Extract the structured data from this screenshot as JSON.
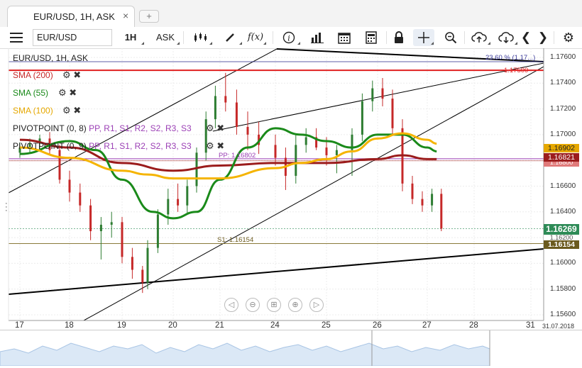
{
  "tab": {
    "label": "EUR/USD, 1H, ASK",
    "close": "×",
    "new_tab": "+"
  },
  "toolbar": {
    "symbol": "EUR/USD",
    "timeframe": "1H",
    "side": "ASK",
    "icons": [
      "hamburger-menu-icon",
      "candle-type-icon",
      "pencil-icon",
      "fx-indicator-icon",
      "info-icon",
      "bar-chart-icon",
      "calendar-icon",
      "report-icon",
      "lock-icon",
      "crosshair-icon",
      "zoom-icon",
      "upload-icon",
      "download-icon",
      "prev-icon",
      "next-icon",
      "settings-icon"
    ]
  },
  "legend": {
    "instrument": "EUR/USD, 1H, ASK",
    "sma200": "SMA (200)",
    "sma55": "SMA (55)",
    "sma100": "SMA (100)",
    "pivot8_name": "PIVOTPOINT (0, 8)",
    "pivot8_levels": "PP, R1, S1, R2, S2, R3, S3",
    "pivot9_name": "PIVOTPOINT (0, 9)",
    "pivot9_levels": "PP, R1, S1, R2, S2, R3, S3"
  },
  "annotations": {
    "fib": "23.60 % (1.17...)",
    "red_level": "1.17500",
    "pp": "PP: 1.16802",
    "s1": "S1: 1.16154"
  },
  "price_boxes": {
    "sma55": "1.16902",
    "sma200": "1.16821",
    "last": "1.16269",
    "s1": "1.16154",
    "hidden1": "1.16800",
    "hidden2": "1.16200"
  },
  "colors": {
    "sma200": "#9b1c1c",
    "sma55": "#1a8a1a",
    "sma100": "#f5b400",
    "pivot": "#9b3fb5",
    "red_level": "#e02020",
    "up": "#2e7d32",
    "down": "#c62828",
    "last_price": "#2e8b57",
    "s1_box": "#6b5a1e"
  },
  "y_axis": [
    "1.17600",
    "1.17400",
    "1.17200",
    "1.17000",
    "1.16800",
    "1.16600",
    "1.16400",
    "1.16200",
    "1.16000",
    "1.15800",
    "1.15600"
  ],
  "x_axis": [
    "17",
    "18",
    "19",
    "20",
    "21",
    "24",
    "25",
    "26",
    "27",
    "28",
    "31"
  ],
  "x_axis_date": "31.07.2018",
  "chart_data": {
    "type": "candlestick",
    "instrument": "EUR/USD",
    "timeframe": "1H",
    "ylim": [
      1.1555,
      1.1765
    ],
    "series_lines": [
      {
        "name": "SMA (200)",
        "x": [
          17,
          18,
          19,
          20,
          21,
          24,
          25,
          26,
          26.5,
          27,
          27.2
        ],
        "y": [
          1.1696,
          1.169,
          1.1678,
          1.1672,
          1.1676,
          1.1678,
          1.1678,
          1.1681,
          1.1684,
          1.1681,
          1.1681
        ]
      },
      {
        "name": "SMA (55)",
        "x": [
          17,
          18,
          18.5,
          19,
          19.6,
          20,
          20.5,
          21,
          21.5,
          24,
          24.5,
          25,
          25.5,
          26,
          26.5,
          27,
          27.2
        ],
        "y": [
          1.1685,
          1.1695,
          1.1688,
          1.1665,
          1.164,
          1.1635,
          1.164,
          1.1665,
          1.169,
          1.1705,
          1.17,
          1.1695,
          1.169,
          1.17,
          1.17,
          1.169,
          1.1687
        ]
      },
      {
        "name": "SMA (100)",
        "x": [
          17,
          18,
          19,
          19.5,
          20,
          21,
          24,
          24.5,
          25,
          25.5,
          26,
          26.5,
          27,
          27.2
        ],
        "y": [
          1.169,
          1.1682,
          1.1672,
          1.1669,
          1.1666,
          1.1666,
          1.1674,
          1.1678,
          1.1681,
          1.1687,
          1.1697,
          1.1701,
          1.1696,
          1.1693
        ]
      }
    ],
    "levels": {
      "pp": 1.16802,
      "s1": 1.16154,
      "red": 1.175,
      "last": 1.16269
    },
    "candles": [
      [
        17.0,
        1.1686,
        1.1694,
        1.1682,
        1.169
      ],
      [
        17.2,
        1.169,
        1.1697,
        1.1686,
        1.1693
      ],
      [
        17.4,
        1.1693,
        1.17,
        1.1689,
        1.1697
      ],
      [
        17.6,
        1.1697,
        1.1702,
        1.1685,
        1.1688
      ],
      [
        17.8,
        1.1688,
        1.1692,
        1.1662,
        1.1665
      ],
      [
        18.0,
        1.1665,
        1.1672,
        1.1648,
        1.1655
      ],
      [
        18.2,
        1.1655,
        1.1662,
        1.164,
        1.1645
      ],
      [
        18.4,
        1.1645,
        1.165,
        1.1618,
        1.1625
      ],
      [
        18.6,
        1.1625,
        1.1636,
        1.1603,
        1.163
      ],
      [
        18.8,
        1.163,
        1.164,
        1.162,
        1.1632
      ],
      [
        19.0,
        1.1632,
        1.1636,
        1.16,
        1.1605
      ],
      [
        19.2,
        1.1605,
        1.1612,
        1.1588,
        1.1595
      ],
      [
        19.4,
        1.1595,
        1.1598,
        1.1577,
        1.1585
      ],
      [
        19.5,
        1.1585,
        1.1618,
        1.158,
        1.1612
      ],
      [
        19.7,
        1.1612,
        1.1642,
        1.1608,
        1.1638
      ],
      [
        19.9,
        1.1638,
        1.1658,
        1.163,
        1.165
      ],
      [
        20.1,
        1.165,
        1.1662,
        1.164,
        1.1645
      ],
      [
        20.3,
        1.1645,
        1.1665,
        1.1638,
        1.166
      ],
      [
        20.5,
        1.166,
        1.169,
        1.1655,
        1.1686
      ],
      [
        20.7,
        1.1686,
        1.1718,
        1.168,
        1.1712
      ],
      [
        20.9,
        1.1712,
        1.1738,
        1.1705,
        1.173
      ],
      [
        21.1,
        1.173,
        1.1748,
        1.1718,
        1.1725
      ],
      [
        21.3,
        1.1725,
        1.1735,
        1.17,
        1.1706
      ],
      [
        21.5,
        1.1706,
        1.1718,
        1.1688,
        1.17
      ],
      [
        21.7,
        1.17,
        1.171,
        1.1685,
        1.1692
      ],
      [
        24.0,
        1.1692,
        1.17,
        1.1676,
        1.1682
      ],
      [
        24.2,
        1.1682,
        1.169,
        1.1657,
        1.1668
      ],
      [
        24.4,
        1.1668,
        1.17,
        1.1662,
        1.1692
      ],
      [
        24.6,
        1.1692,
        1.1705,
        1.1686,
        1.1698
      ],
      [
        24.8,
        1.1698,
        1.1705,
        1.1688,
        1.169
      ],
      [
        25.0,
        1.169,
        1.1698,
        1.1676,
        1.1684
      ],
      [
        25.2,
        1.1684,
        1.1692,
        1.167,
        1.1688
      ],
      [
        25.5,
        1.1688,
        1.1705,
        1.1668,
        1.17
      ],
      [
        25.7,
        1.17,
        1.1732,
        1.1695,
        1.1726
      ],
      [
        25.9,
        1.1726,
        1.1742,
        1.1718,
        1.1736
      ],
      [
        26.1,
        1.1736,
        1.1744,
        1.1722,
        1.1728
      ],
      [
        26.3,
        1.1728,
        1.1735,
        1.17,
        1.1705
      ],
      [
        26.5,
        1.1705,
        1.1712,
        1.1656,
        1.1662
      ],
      [
        26.7,
        1.1662,
        1.1668,
        1.1646,
        1.165
      ],
      [
        26.9,
        1.165,
        1.1656,
        1.164,
        1.1645
      ],
      [
        27.1,
        1.1645,
        1.1658,
        1.164,
        1.1654
      ],
      [
        27.3,
        1.1654,
        1.1658,
        1.1625,
        1.1627
      ]
    ]
  },
  "nav_buttons": [
    "◁",
    "⊖",
    "⊞",
    "⊕",
    "▷"
  ]
}
